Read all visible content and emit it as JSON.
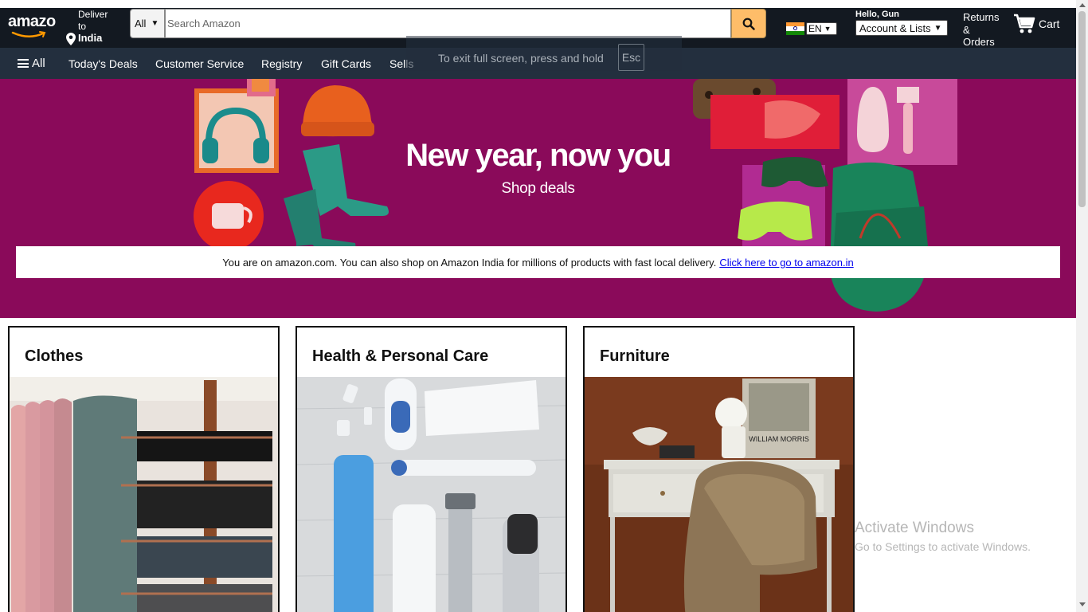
{
  "header": {
    "logo_text": "amazo",
    "deliver_line1": "Deliver",
    "deliver_line2": "to",
    "deliver_country": "India",
    "search_category": "All",
    "search_placeholder": "Search Amazon",
    "language": "EN",
    "greeting": "Hello, Gun",
    "account_select": "Account & Lists",
    "returns_line1": "Returns",
    "returns_line2": "&",
    "returns_line3": "Orders",
    "cart_label": "Cart"
  },
  "subnav": {
    "all_label": "All",
    "items": [
      "Today's Deals",
      "Customer Service",
      "Registry",
      "Gift Cards",
      "Sells"
    ]
  },
  "fullscreen_toast": {
    "message": "To exit full screen, press and hold",
    "key": "Esc"
  },
  "hero": {
    "title": "New year, now you",
    "subtitle": "Shop deals",
    "notice_text": "You are on amazon.com. You can also shop on Amazon India for millions of products with fast local delivery.",
    "notice_link": "Click here to go to amazon.in"
  },
  "cards": [
    {
      "title": "Clothes"
    },
    {
      "title": "Health & Personal Care"
    },
    {
      "title": "Furniture"
    }
  ],
  "furniture_poster_text": "WILLIAM MORRIS",
  "watermark": {
    "line1": "Activate Windows",
    "line2": "Go to Settings to activate Windows."
  },
  "colors": {
    "nav_top": "#131921",
    "nav_sub": "#232f3e",
    "search_button": "#febd69",
    "hero_bg": "#8a0a5a",
    "logo_accent": "#ff9900"
  },
  "icons": [
    "amazon-smile-icon",
    "location-pin-icon",
    "search-icon",
    "india-flag-icon",
    "cart-icon",
    "hamburger-icon"
  ]
}
